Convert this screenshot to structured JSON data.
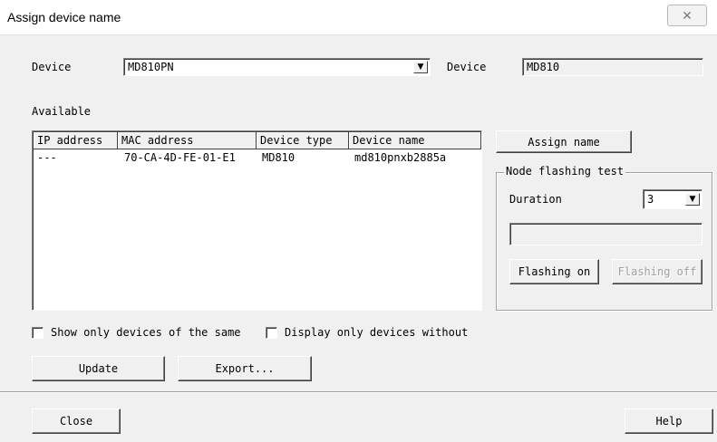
{
  "window": {
    "title": "Assign device name",
    "close_icon": "close-icon"
  },
  "device_row": {
    "label": "Device",
    "select_value": "MD810PN",
    "label2": "Device",
    "readonly_value": "MD810"
  },
  "available_label": "Available",
  "table": {
    "columns": [
      "IP address",
      "MAC address",
      "Device type",
      "Device name"
    ],
    "rows": [
      [
        "---",
        "70-CA-4D-FE-01-E1",
        "MD810",
        "md810pnxb2885a"
      ]
    ]
  },
  "assign_button": "Assign name",
  "flash_group": {
    "title": "Node flashing test",
    "duration_label": "Duration",
    "duration_value": "3",
    "status_value": "",
    "flashing_on": "Flashing on",
    "flashing_off": "Flashing off"
  },
  "options": {
    "show_same_label": "Show only devices of the same",
    "show_same_checked": false,
    "without_name_label": "Display only devices without",
    "without_name_checked": false
  },
  "buttons": {
    "update": "Update",
    "export": "Export...",
    "close": "Close",
    "help": "Help"
  }
}
